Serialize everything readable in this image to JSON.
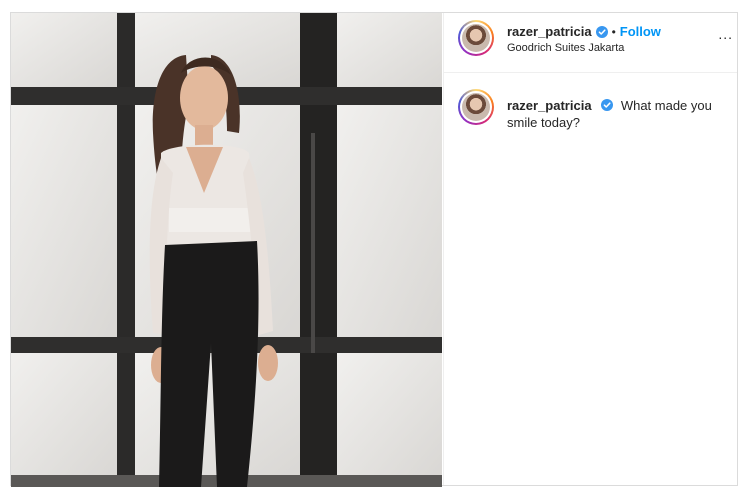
{
  "post": {
    "username": "razer_patricia",
    "dot": "•",
    "follow_label": "Follow",
    "location": "Goodrich Suites Jakarta",
    "more_label": "..."
  },
  "caption": {
    "username": "razer_patricia",
    "text": "What made you smile today?"
  },
  "colors": {
    "follow_blue": "#0095f6",
    "verified_blue": "#3897f0",
    "text": "#262626"
  },
  "icons": {
    "verified": "verified-badge-icon",
    "more": "more-options-icon"
  }
}
